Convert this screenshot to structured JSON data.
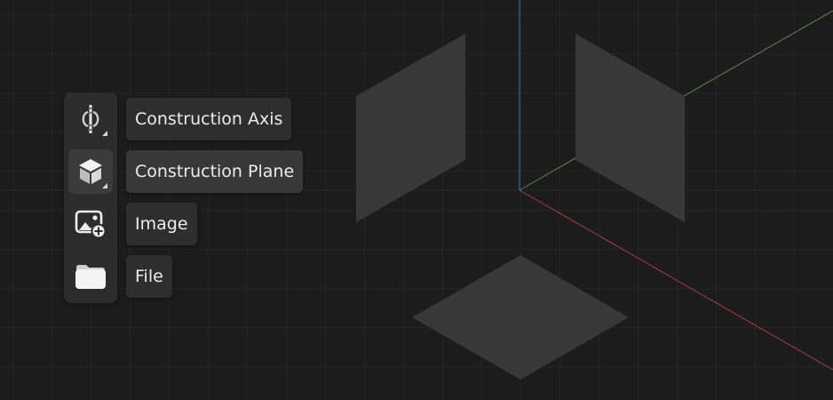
{
  "toolbar": {
    "items": [
      {
        "icon": "construction-axis-icon",
        "label": "Construction Axis",
        "has_submenu": true
      },
      {
        "icon": "construction-plane-icon",
        "label": "Construction Plane",
        "has_submenu": true,
        "active": true
      },
      {
        "icon": "add-image-icon",
        "label": "Image",
        "has_submenu": false
      },
      {
        "icon": "folder-icon",
        "label": "File",
        "has_submenu": false
      }
    ]
  },
  "scene": {
    "axis_colors": {
      "x": "#c0454b",
      "y": "#6c9c55",
      "z": "#4a86c8"
    },
    "plane_color": "#3a3a3a",
    "background_color": "#1c1c1c"
  }
}
